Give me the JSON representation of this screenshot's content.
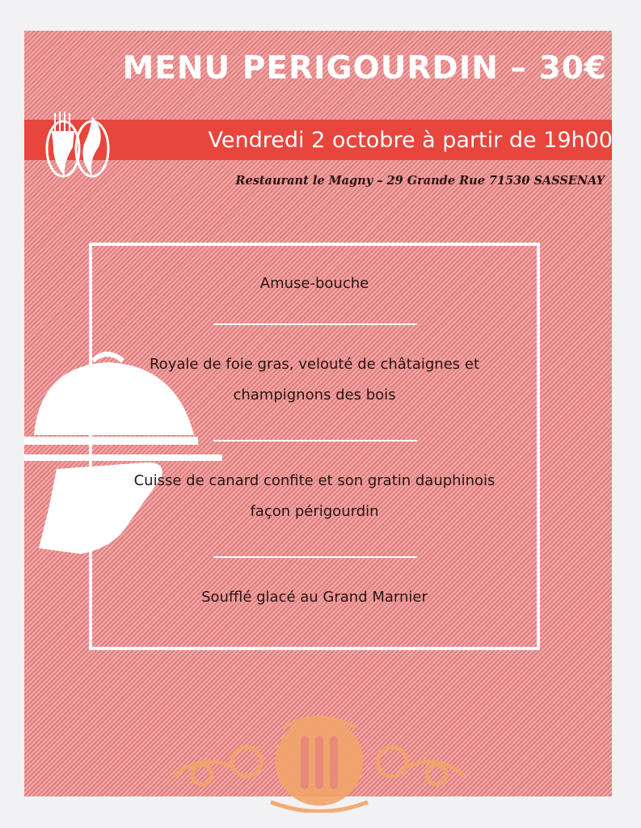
{
  "header": {
    "title": "MENU PERIGOURDIN – 30€",
    "date": "Vendredi 2 octobre à partir de 19h00",
    "address": "Restaurant le Magny – 29 Grande Rue 71530 SASSENAY"
  },
  "menu": {
    "items": [
      {
        "lines": [
          "Amuse-bouche"
        ]
      },
      {
        "lines": [
          "Royale de foie gras, velouté de châtaignes et",
          "champignons des bois"
        ]
      },
      {
        "lines": [
          "Cuisse de canard confite et son gratin dauphinois",
          "façon  périgourdin"
        ]
      },
      {
        "lines": [
          "Soufflé glacé au Grand Marnier"
        ]
      }
    ]
  },
  "colors": {
    "band": "#e8453c",
    "panel": "#e58a8a",
    "logo": "#f2a46a"
  }
}
